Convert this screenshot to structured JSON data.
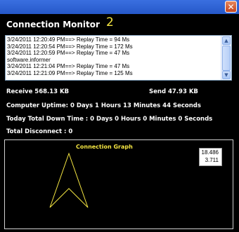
{
  "window": {
    "close_label": "✕"
  },
  "header": {
    "title": "Connection Monitor",
    "connection_count": "2"
  },
  "log": {
    "lines": [
      "3/24/2011 12:20:49 PM==> Replay Time = 94 Ms",
      "3/24/2011 12:20:54 PM==> Replay Time = 172 Ms",
      "3/24/2011 12:20:59 PM==> Replay Time = 47 Ms",
      "software.informer",
      "3/24/2011 12:21:04 PM==> Replay Time = 47 Ms",
      "3/24/2011 12:21:09 PM==> Replay Time = 125 Ms"
    ]
  },
  "stats": {
    "receive": "Receive 568.13 KB",
    "send": "Send 47.93 KB",
    "uptime": "Computer Uptime: 0 Days 1 Hours 13 Minutes 44 Seconds",
    "downtime": "Today Total Down Time : 0 Days 0 Hours 0 Minutes 0 Seconds",
    "disconnects": "Total Disconnect : 0"
  },
  "graph": {
    "title": "Connection Graph",
    "value_1": "18.486",
    "value_2": "3.711",
    "line_color": "#f5e642"
  }
}
